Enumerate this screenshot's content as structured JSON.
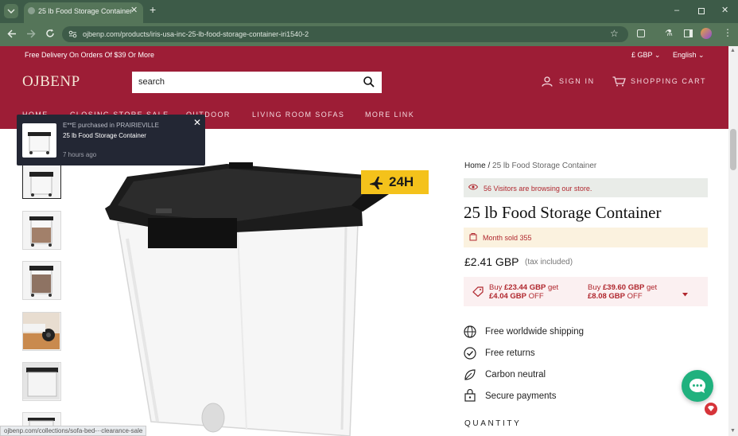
{
  "browser": {
    "tab_title": "25 lb Food Storage Container",
    "url": "ojbenp.com/products/iris-usa-inc-25-lb-food-storage-container-iri1540-2",
    "status_url": "ojbenp.com/collections/sofa-bed-··clearance-sale"
  },
  "header": {
    "promo": "Free Delivery On Orders Of $39 Or More",
    "currency": "£ GBP",
    "language": "English",
    "logo": "OJBENP",
    "search_placeholder": "search",
    "sign_in": "SIGN IN",
    "cart": "SHOPPING CART",
    "nav": [
      "HOME",
      "CLOSING STORE SALE",
      "OUTDOOR",
      "LIVING ROOM SOFAS",
      "MORE LINK"
    ]
  },
  "notification": {
    "line1": "E**E purchased in PRAIRIEVILLE",
    "product": "25 lb Food Storage Container",
    "time": "7 hours ago"
  },
  "product": {
    "badge": "24H",
    "breadcrumb_home": "Home",
    "breadcrumb_sep": "/",
    "breadcrumb_current": "25 lb Food Storage Container",
    "visitors": "56 Visitors are browsing our store.",
    "title": "25 lb Food Storage Container",
    "sold": "Month sold 355",
    "price": "£2.41 GBP",
    "tax": "(tax included)",
    "offers": [
      {
        "buy": "Buy ",
        "amount": "£23.44 GBP",
        "get": " get",
        "discount": "£4.04 GBP",
        "off": " OFF"
      },
      {
        "buy": "Buy ",
        "amount": "£39.60 GBP",
        "get": " get",
        "discount": "£8.08 GBP",
        "off": " OFF"
      }
    ],
    "features": [
      "Free worldwide shipping",
      "Free returns",
      "Carbon neutral",
      "Secure payments"
    ],
    "quantity_label": "QUANTITY"
  },
  "colors": {
    "header_bg": "#9d1d36",
    "chrome_bg": "#557559",
    "badge": "#f4c21b",
    "chat": "#20b17e"
  }
}
